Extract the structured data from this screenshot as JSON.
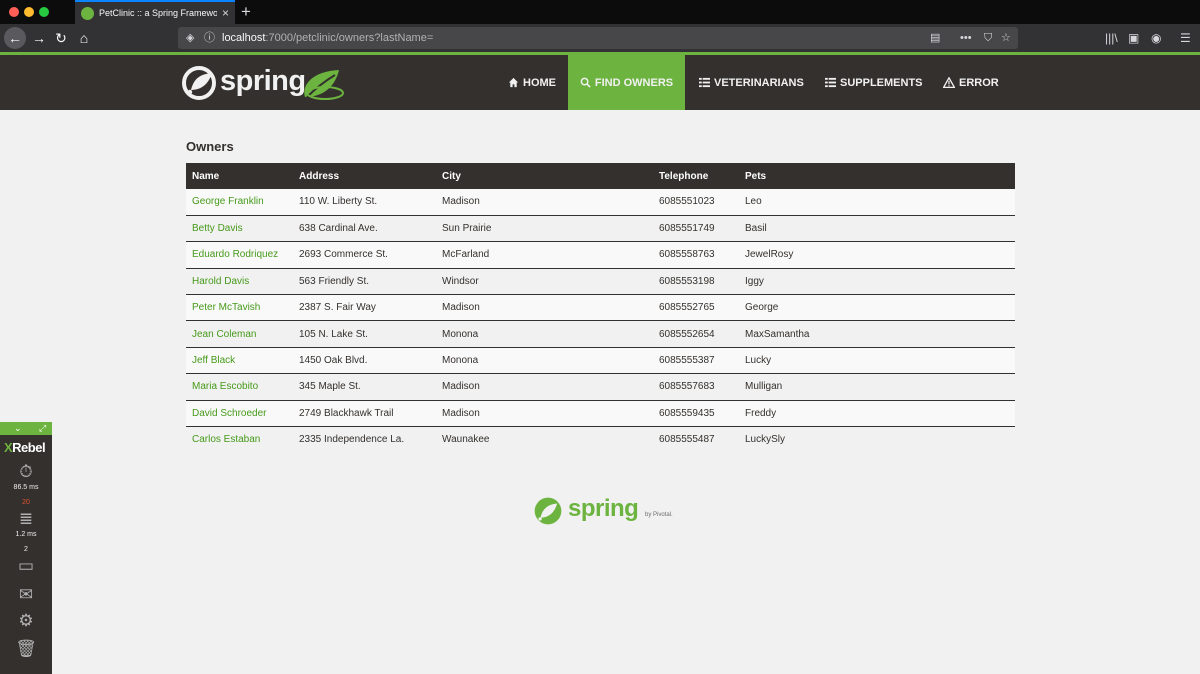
{
  "browser": {
    "tab_title": "PetClinic :: a Spring Framework",
    "url_host": "localhost",
    "url_rest": ":7000/petclinic/owners?lastName="
  },
  "nav": {
    "brand": "spring",
    "items": [
      {
        "label": "HOME",
        "icon": "home-icon"
      },
      {
        "label": "FIND OWNERS",
        "icon": "search-icon"
      },
      {
        "label": "VETERINARIANS",
        "icon": "list-icon"
      },
      {
        "label": "SUPPLEMENTS",
        "icon": "list-icon"
      },
      {
        "label": "ERROR",
        "icon": "warning-icon"
      }
    ],
    "active_color": "#6db33f",
    "bar_color": "#34302d"
  },
  "page": {
    "title": "Owners",
    "columns": [
      "Name",
      "Address",
      "City",
      "Telephone",
      "Pets"
    ],
    "rows": [
      {
        "name": "George Franklin",
        "address": "110 W. Liberty St.",
        "city": "Madison",
        "telephone": "6085551023",
        "pets": "Leo"
      },
      {
        "name": "Betty Davis",
        "address": "638 Cardinal Ave.",
        "city": "Sun Prairie",
        "telephone": "6085551749",
        "pets": "Basil"
      },
      {
        "name": "Eduardo Rodriquez",
        "address": "2693 Commerce St.",
        "city": "McFarland",
        "telephone": "6085558763",
        "pets": "JewelRosy"
      },
      {
        "name": "Harold Davis",
        "address": "563 Friendly St.",
        "city": "Windsor",
        "telephone": "6085553198",
        "pets": "Iggy"
      },
      {
        "name": "Peter McTavish",
        "address": "2387 S. Fair Way",
        "city": "Madison",
        "telephone": "6085552765",
        "pets": "George"
      },
      {
        "name": "Jean Coleman",
        "address": "105 N. Lake St.",
        "city": "Monona",
        "telephone": "6085552654",
        "pets": "MaxSamantha"
      },
      {
        "name": "Jeff Black",
        "address": "1450 Oak Blvd.",
        "city": "Monona",
        "telephone": "6085555387",
        "pets": "Lucky"
      },
      {
        "name": "Maria Escobito",
        "address": "345 Maple St.",
        "city": "Madison",
        "telephone": "6085557683",
        "pets": "Mulligan"
      },
      {
        "name": "David Schroeder",
        "address": "2749 Blackhawk Trail",
        "city": "Madison",
        "telephone": "6085559435",
        "pets": "Freddy"
      },
      {
        "name": "Carlos Estaban",
        "address": "2335 Independence La.",
        "city": "Waunakee",
        "telephone": "6085555487",
        "pets": "LuckySly"
      }
    ]
  },
  "footer": {
    "brand": "spring",
    "byline": "by Pivotal."
  },
  "xrebel": {
    "logo_x": "X",
    "logo_rest": "Rebel",
    "timer_value": "86.5 ms",
    "db_count": "20",
    "db_time": "1.2 ms",
    "screen_count": "2"
  }
}
